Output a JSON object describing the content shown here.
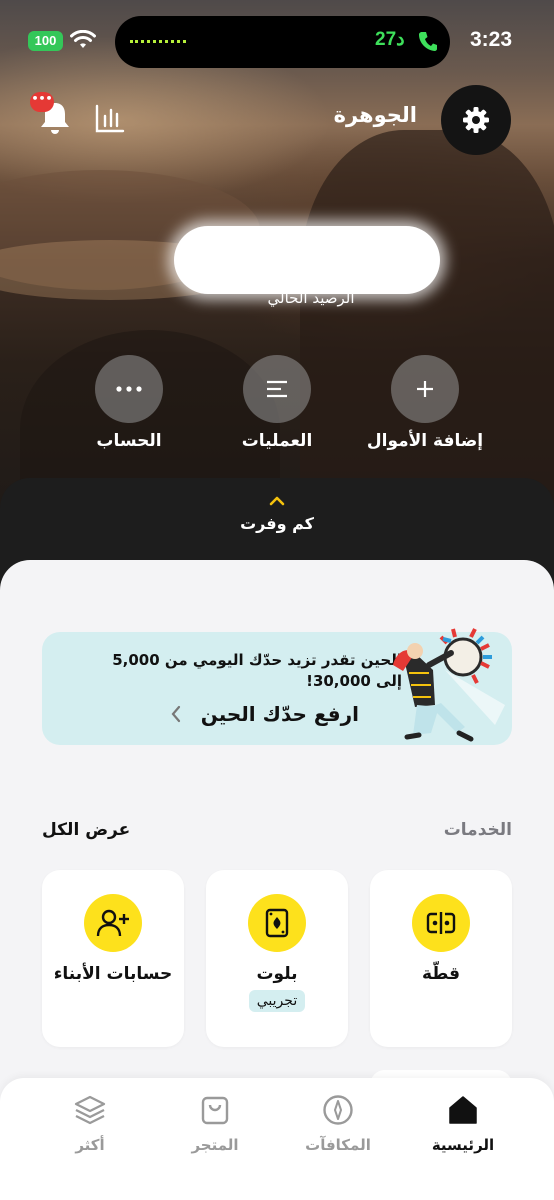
{
  "status_bar": {
    "time": "3:23",
    "battery": "100",
    "call_duration": "27د"
  },
  "header": {
    "account_name": "الجوهرة",
    "notification_badge": "•••"
  },
  "balance": {
    "label": "الرصيد الحالي"
  },
  "actions": [
    {
      "label": "إضافة الأموال",
      "icon": "plus-icon"
    },
    {
      "label": "العمليات",
      "icon": "list-icon"
    },
    {
      "label": "الحساب",
      "icon": "more-icon"
    }
  ],
  "savings": {
    "label": "كم وفرت"
  },
  "promo": {
    "text": "الحين تقدر تزيد حدّك اليومي من 5,000 إلى 30,000!",
    "cta": "ارفع حدّك الحين"
  },
  "services": {
    "title": "الخدمات",
    "see_all": "عرض الكل",
    "items": [
      {
        "name": "قطّة",
        "icon": "split-bill-icon"
      },
      {
        "name": "بلوت",
        "icon": "playing-card-icon",
        "tag": "تجريبي"
      },
      {
        "name": "حسابات الأبناء",
        "icon": "add-person-icon"
      }
    ]
  },
  "tabbar": {
    "items": [
      {
        "label": "الرئيسية",
        "icon": "home-icon",
        "active": true
      },
      {
        "label": "المكافآت",
        "icon": "compass-icon"
      },
      {
        "label": "المتجر",
        "icon": "bag-icon"
      },
      {
        "label": "أكثر",
        "icon": "layers-icon"
      }
    ]
  },
  "colors": {
    "accent_yellow": "#fde11c",
    "promo_bg": "#d4eef0",
    "battery_green": "#34c759"
  }
}
